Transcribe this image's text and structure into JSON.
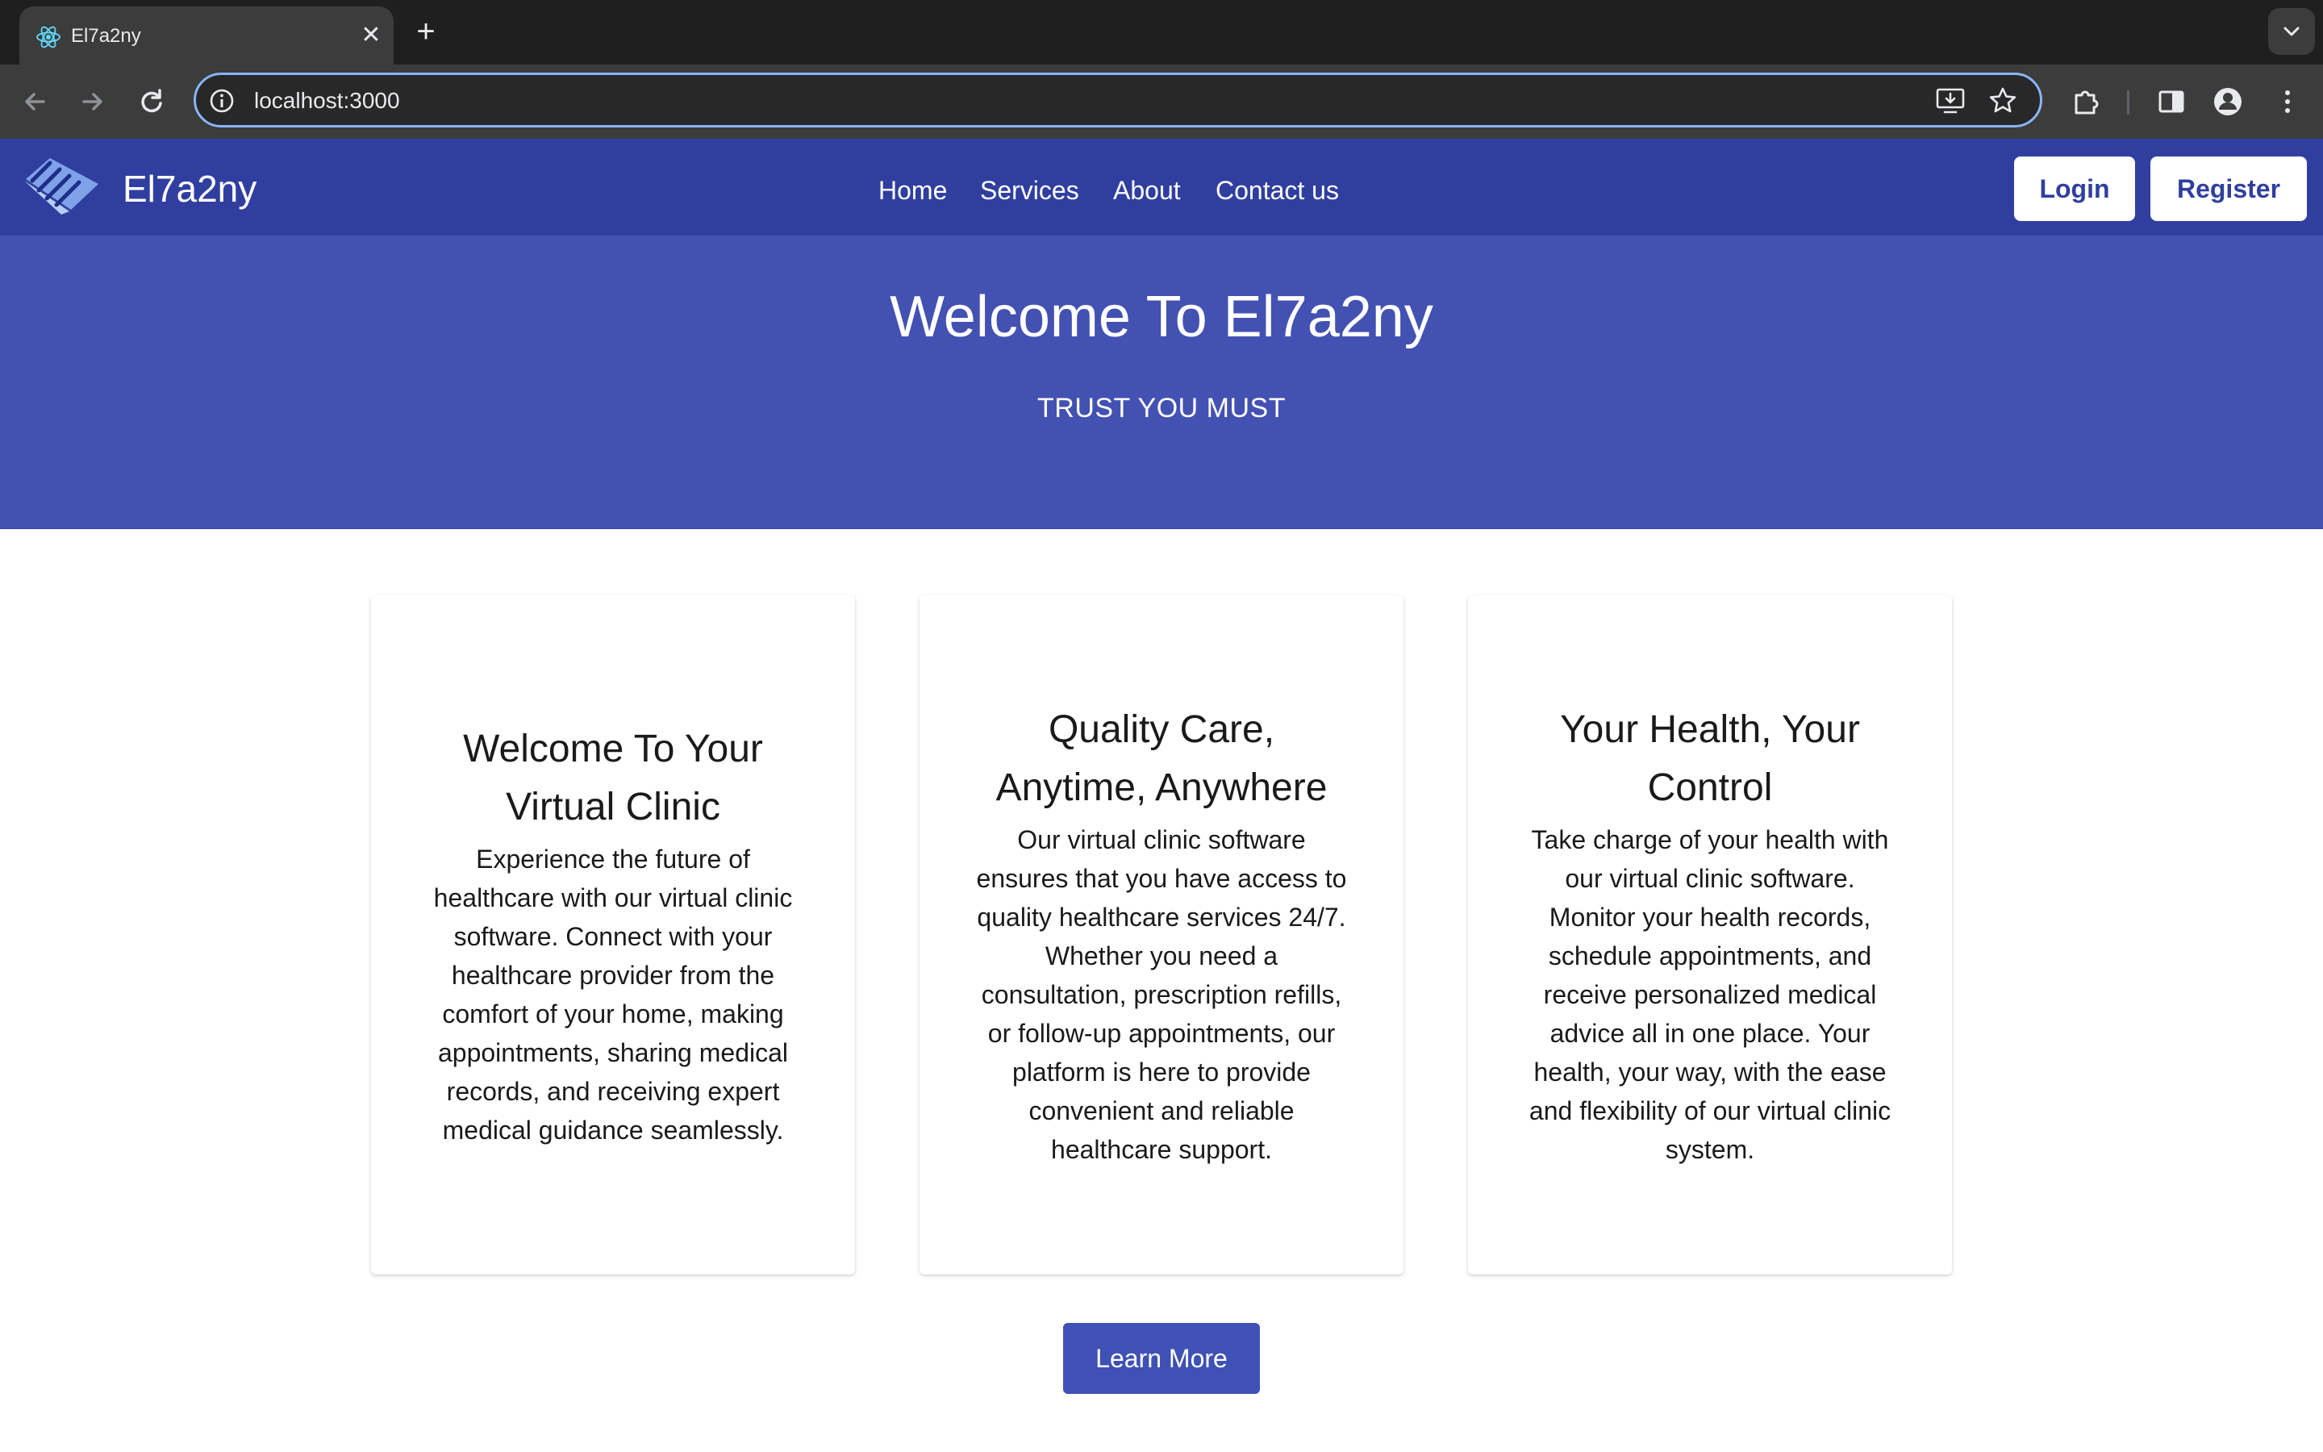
{
  "browser": {
    "tab_title": "El7a2ny",
    "tab_favicon": "react-icon",
    "url": "localhost:3000"
  },
  "navbar": {
    "brand": "El7a2ny",
    "links": [
      "Home",
      "Services",
      "About",
      "Contact us"
    ],
    "login_label": "Login",
    "register_label": "Register",
    "color": "#303f9f"
  },
  "hero": {
    "title": "Welcome To El7a2ny",
    "subtitle": "TRUST YOU MUST",
    "color": "#4351b2"
  },
  "cards": [
    {
      "title": "Welcome To Your Virtual Clinic",
      "text": "Experience the future of healthcare with our virtual clinic software. Connect with your healthcare provider from the comfort of your home, making appointments, sharing medical records, and receiving expert medical guidance seamlessly."
    },
    {
      "title": "Quality Care, Anytime, Anywhere",
      "text": "Our virtual clinic software ensures that you have access to quality healthcare services 24/7. Whether you need a consultation, prescription refills, or follow-up appointments, our platform is here to provide convenient and reliable healthcare support."
    },
    {
      "title": "Your Health, Your Control",
      "text": "Take charge of your health with our virtual clinic software. Monitor your health records, schedule appointments, and receive personalized medical advice all in one place. Your health, your way, with the ease and flexibility of our virtual clinic system."
    }
  ],
  "learn_more_label": "Learn More"
}
